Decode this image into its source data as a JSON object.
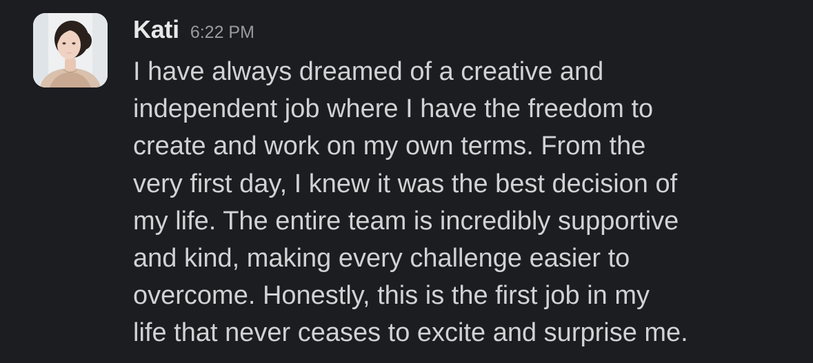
{
  "message": {
    "author": "Kati",
    "time": "6:22 PM",
    "avatar_icon": "user-avatar-photo",
    "lines": [
      "I have always dreamed of a creative and",
      "independent job where I have the freedom to",
      "create and work on my own terms. From the",
      "very first day, I knew it was the best decision of",
      "my life. The entire team is incredibly supportive",
      "and kind, making every challenge easier to",
      "overcome. Honestly, this is the first job in my",
      "life that never ceases to excite and surprise me."
    ]
  },
  "colors": {
    "background": "#1b1d21",
    "author": "#e8e8e8",
    "timestamp": "#9a9b9e",
    "text": "#d1d2d3"
  }
}
